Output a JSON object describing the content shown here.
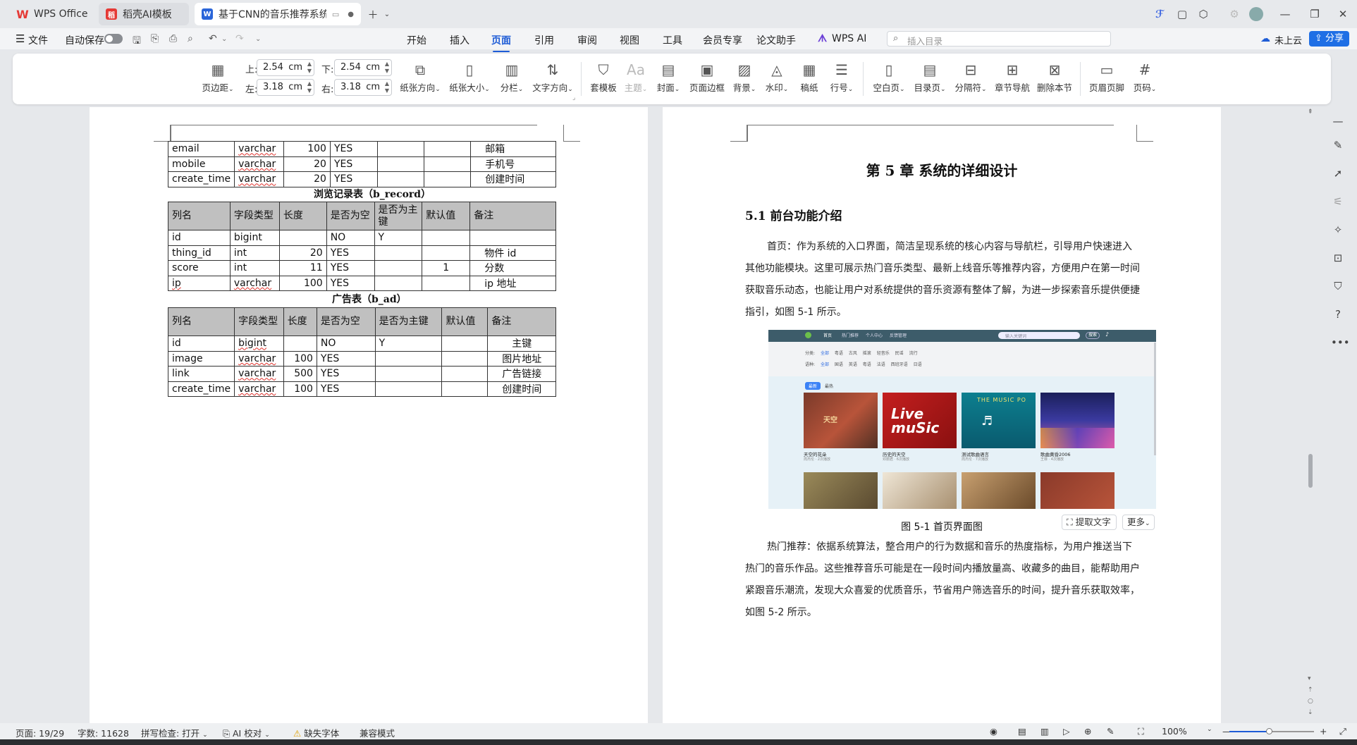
{
  "tabs": [
    {
      "label": "WPS Office",
      "icon": "wps-logo-icon"
    },
    {
      "label": "稻壳AI模板",
      "icon": "docer-icon"
    },
    {
      "label": "基于CNN的音乐推荐系统设计",
      "icon": "word-doc-icon"
    }
  ],
  "menubar": {
    "file_label": "文件",
    "autosave_label": "自动保存",
    "items": [
      "开始",
      "插入",
      "页面",
      "引用",
      "审阅",
      "视图",
      "工具",
      "会员专享",
      "论文助手",
      "WPS AI"
    ],
    "active_index": 2,
    "search_placeholder": "插入目录",
    "cloud_label": "未上云",
    "share_label": "分享"
  },
  "ribbon": {
    "margins_label": "页边距",
    "top_label": "上:",
    "top_value": "2.54",
    "bottom_label": "下:",
    "bottom_value": "2.54",
    "left_label": "左:",
    "left_value": "3.18",
    "right_label": "右:",
    "right_value": "3.18",
    "unit": "cm",
    "buttons": [
      "纸张方向",
      "纸张大小",
      "分栏",
      "文字方向",
      "套模板",
      "主题",
      "封面",
      "页面边框",
      "背景",
      "水印",
      "稿纸",
      "行号",
      "空白页",
      "目录页",
      "分隔符",
      "章节导航",
      "删除本节",
      "页眉页脚",
      "页码"
    ]
  },
  "left_page": {
    "top_table": {
      "rows": [
        [
          "email",
          "varchar",
          "100",
          "YES",
          "",
          "",
          "邮箱"
        ],
        [
          "mobile",
          "varchar",
          "20",
          "YES",
          "",
          "",
          "手机号"
        ],
        [
          "create_time",
          "varchar",
          "20",
          "YES",
          "",
          "",
          "创建时间"
        ]
      ]
    },
    "record_caption": "浏览记录表（b_record）",
    "record_table": {
      "headers": [
        "列名",
        "字段类型",
        "长度",
        "是否为空",
        "是否为主键",
        "默认值",
        "备注"
      ],
      "rows": [
        [
          "id",
          "bigint",
          "",
          "NO",
          "Y",
          "",
          ""
        ],
        [
          "thing_id",
          "int",
          "20",
          "YES",
          "",
          "",
          "物件 id"
        ],
        [
          "score",
          "int",
          "11",
          "YES",
          "",
          "1",
          "分数"
        ],
        [
          "ip",
          "varchar",
          "100",
          "YES",
          "",
          "",
          "ip 地址"
        ]
      ]
    },
    "ad_caption": "广告表（b_ad）",
    "ad_table": {
      "headers": [
        "列名",
        "字段类型",
        "长度",
        "是否为空",
        "是否为主键",
        "默认值",
        "备注"
      ],
      "rows": [
        [
          "id",
          "bigint",
          "",
          "NO",
          "Y",
          "",
          "主键"
        ],
        [
          "image",
          "varchar",
          "100",
          "YES",
          "",
          "",
          "图片地址"
        ],
        [
          "link",
          "varchar",
          "500",
          "YES",
          "",
          "",
          "广告链接"
        ],
        [
          "create_time",
          "varchar",
          "100",
          "YES",
          "",
          "",
          "创建时间"
        ]
      ]
    }
  },
  "right_page": {
    "chapter_title": "第 5 章  系统的详细设计",
    "section_title": "5.1  前台功能介绍",
    "para1_lines": [
      "首页：作为系统的入口界面，简洁呈现系统的核心内容与导航栏，引导用户快速进入",
      "其他功能模块。这里可展示热门音乐类型、最新上线音乐等推荐内容，方便用户在第一时间",
      "获取音乐动态，也能让用户对系统提供的音乐资源有整体了解，为进一步探索音乐提供便捷",
      "指引，如图 5-1 所示。"
    ],
    "figure": {
      "nav_items": [
        "首页",
        "热门推荐",
        "个人中心",
        "反馈管理"
      ],
      "search_placeholder": "输入关键词",
      "search_button": "搜索",
      "filter_rows": [
        {
          "label": "分类:",
          "items": [
            "全部",
            "粤语",
            "古风",
            "摇滚",
            "轻音乐",
            "民谣",
            "流行"
          ]
        },
        {
          "label": "语种:",
          "items": [
            "全部",
            "国语",
            "英语",
            "粤语",
            "法语",
            "西班牙语",
            "日语"
          ]
        }
      ],
      "tabs": [
        "最新",
        "最热"
      ],
      "cards": [
        {
          "title": "天空的花朵",
          "sub": "周杰伦 · 2次播放",
          "art": "天空"
        },
        {
          "title": "历史的天空",
          "sub": "邓丽君 · 6次播放",
          "art": "Live muSic"
        },
        {
          "title": "测试歌曲语言",
          "sub": "周杰伦 · 7次播放",
          "art": "THE MUSIC PO"
        },
        {
          "title": "歌曲黄昏2006",
          "sub": "王菲 · 4次播放",
          "art": ""
        }
      ],
      "caption": "图 5-1  首页界面图",
      "extract_label": "提取文字",
      "more_label": "更多"
    },
    "para2_lines": [
      "热门推荐：依据系统算法，整合用户的行为数据和音乐的热度指标，为用户推送当下",
      "热门的音乐作品。这些推荐音乐可能是在一段时间内播放量高、收藏多的曲目，能帮助用户",
      "紧跟音乐潮流，发现大众喜爱的优质音乐，节省用户筛选音乐的时间，提升音乐获取效率，",
      "如图 5-2 所示。"
    ]
  },
  "statusbar": {
    "page": "页面: 19/29",
    "words": "字数: 11628",
    "spell": "拼写检查: 打开",
    "ai_check": "AI 校对",
    "missing_font": "缺失字体",
    "compat": "兼容模式",
    "zoom": "100%"
  },
  "colors": {
    "accent": "#1e5cd6",
    "wps_red": "#e53935",
    "table_header": "#c0c0c0",
    "share_button": "#1f6fe5",
    "figure_nav": "#3d5c6a"
  }
}
